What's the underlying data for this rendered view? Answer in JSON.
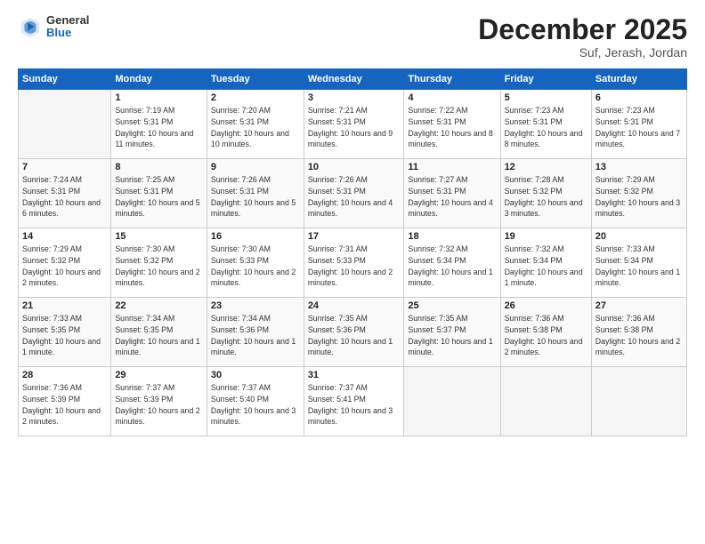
{
  "logo": {
    "general": "General",
    "blue": "Blue"
  },
  "header": {
    "title": "December 2025",
    "subtitle": "Suf, Jerash, Jordan"
  },
  "columns": [
    "Sunday",
    "Monday",
    "Tuesday",
    "Wednesday",
    "Thursday",
    "Friday",
    "Saturday"
  ],
  "weeks": [
    [
      {
        "day": "",
        "sunrise": "",
        "sunset": "",
        "daylight": ""
      },
      {
        "day": "1",
        "sunrise": "Sunrise: 7:19 AM",
        "sunset": "Sunset: 5:31 PM",
        "daylight": "Daylight: 10 hours and 11 minutes."
      },
      {
        "day": "2",
        "sunrise": "Sunrise: 7:20 AM",
        "sunset": "Sunset: 5:31 PM",
        "daylight": "Daylight: 10 hours and 10 minutes."
      },
      {
        "day": "3",
        "sunrise": "Sunrise: 7:21 AM",
        "sunset": "Sunset: 5:31 PM",
        "daylight": "Daylight: 10 hours and 9 minutes."
      },
      {
        "day": "4",
        "sunrise": "Sunrise: 7:22 AM",
        "sunset": "Sunset: 5:31 PM",
        "daylight": "Daylight: 10 hours and 8 minutes."
      },
      {
        "day": "5",
        "sunrise": "Sunrise: 7:23 AM",
        "sunset": "Sunset: 5:31 PM",
        "daylight": "Daylight: 10 hours and 8 minutes."
      },
      {
        "day": "6",
        "sunrise": "Sunrise: 7:23 AM",
        "sunset": "Sunset: 5:31 PM",
        "daylight": "Daylight: 10 hours and 7 minutes."
      }
    ],
    [
      {
        "day": "7",
        "sunrise": "Sunrise: 7:24 AM",
        "sunset": "Sunset: 5:31 PM",
        "daylight": "Daylight: 10 hours and 6 minutes."
      },
      {
        "day": "8",
        "sunrise": "Sunrise: 7:25 AM",
        "sunset": "Sunset: 5:31 PM",
        "daylight": "Daylight: 10 hours and 5 minutes."
      },
      {
        "day": "9",
        "sunrise": "Sunrise: 7:26 AM",
        "sunset": "Sunset: 5:31 PM",
        "daylight": "Daylight: 10 hours and 5 minutes."
      },
      {
        "day": "10",
        "sunrise": "Sunrise: 7:26 AM",
        "sunset": "Sunset: 5:31 PM",
        "daylight": "Daylight: 10 hours and 4 minutes."
      },
      {
        "day": "11",
        "sunrise": "Sunrise: 7:27 AM",
        "sunset": "Sunset: 5:31 PM",
        "daylight": "Daylight: 10 hours and 4 minutes."
      },
      {
        "day": "12",
        "sunrise": "Sunrise: 7:28 AM",
        "sunset": "Sunset: 5:32 PM",
        "daylight": "Daylight: 10 hours and 3 minutes."
      },
      {
        "day": "13",
        "sunrise": "Sunrise: 7:29 AM",
        "sunset": "Sunset: 5:32 PM",
        "daylight": "Daylight: 10 hours and 3 minutes."
      }
    ],
    [
      {
        "day": "14",
        "sunrise": "Sunrise: 7:29 AM",
        "sunset": "Sunset: 5:32 PM",
        "daylight": "Daylight: 10 hours and 2 minutes."
      },
      {
        "day": "15",
        "sunrise": "Sunrise: 7:30 AM",
        "sunset": "Sunset: 5:32 PM",
        "daylight": "Daylight: 10 hours and 2 minutes."
      },
      {
        "day": "16",
        "sunrise": "Sunrise: 7:30 AM",
        "sunset": "Sunset: 5:33 PM",
        "daylight": "Daylight: 10 hours and 2 minutes."
      },
      {
        "day": "17",
        "sunrise": "Sunrise: 7:31 AM",
        "sunset": "Sunset: 5:33 PM",
        "daylight": "Daylight: 10 hours and 2 minutes."
      },
      {
        "day": "18",
        "sunrise": "Sunrise: 7:32 AM",
        "sunset": "Sunset: 5:34 PM",
        "daylight": "Daylight: 10 hours and 1 minute."
      },
      {
        "day": "19",
        "sunrise": "Sunrise: 7:32 AM",
        "sunset": "Sunset: 5:34 PM",
        "daylight": "Daylight: 10 hours and 1 minute."
      },
      {
        "day": "20",
        "sunrise": "Sunrise: 7:33 AM",
        "sunset": "Sunset: 5:34 PM",
        "daylight": "Daylight: 10 hours and 1 minute."
      }
    ],
    [
      {
        "day": "21",
        "sunrise": "Sunrise: 7:33 AM",
        "sunset": "Sunset: 5:35 PM",
        "daylight": "Daylight: 10 hours and 1 minute."
      },
      {
        "day": "22",
        "sunrise": "Sunrise: 7:34 AM",
        "sunset": "Sunset: 5:35 PM",
        "daylight": "Daylight: 10 hours and 1 minute."
      },
      {
        "day": "23",
        "sunrise": "Sunrise: 7:34 AM",
        "sunset": "Sunset: 5:36 PM",
        "daylight": "Daylight: 10 hours and 1 minute."
      },
      {
        "day": "24",
        "sunrise": "Sunrise: 7:35 AM",
        "sunset": "Sunset: 5:36 PM",
        "daylight": "Daylight: 10 hours and 1 minute."
      },
      {
        "day": "25",
        "sunrise": "Sunrise: 7:35 AM",
        "sunset": "Sunset: 5:37 PM",
        "daylight": "Daylight: 10 hours and 1 minute."
      },
      {
        "day": "26",
        "sunrise": "Sunrise: 7:36 AM",
        "sunset": "Sunset: 5:38 PM",
        "daylight": "Daylight: 10 hours and 2 minutes."
      },
      {
        "day": "27",
        "sunrise": "Sunrise: 7:36 AM",
        "sunset": "Sunset: 5:38 PM",
        "daylight": "Daylight: 10 hours and 2 minutes."
      }
    ],
    [
      {
        "day": "28",
        "sunrise": "Sunrise: 7:36 AM",
        "sunset": "Sunset: 5:39 PM",
        "daylight": "Daylight: 10 hours and 2 minutes."
      },
      {
        "day": "29",
        "sunrise": "Sunrise: 7:37 AM",
        "sunset": "Sunset: 5:39 PM",
        "daylight": "Daylight: 10 hours and 2 minutes."
      },
      {
        "day": "30",
        "sunrise": "Sunrise: 7:37 AM",
        "sunset": "Sunset: 5:40 PM",
        "daylight": "Daylight: 10 hours and 3 minutes."
      },
      {
        "day": "31",
        "sunrise": "Sunrise: 7:37 AM",
        "sunset": "Sunset: 5:41 PM",
        "daylight": "Daylight: 10 hours and 3 minutes."
      },
      {
        "day": "",
        "sunrise": "",
        "sunset": "",
        "daylight": ""
      },
      {
        "day": "",
        "sunrise": "",
        "sunset": "",
        "daylight": ""
      },
      {
        "day": "",
        "sunrise": "",
        "sunset": "",
        "daylight": ""
      }
    ]
  ]
}
